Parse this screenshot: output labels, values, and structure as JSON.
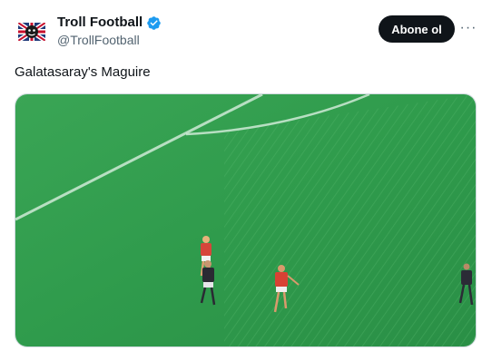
{
  "tweet": {
    "author": {
      "display_name": "Troll Football",
      "handle": "@TrollFootball",
      "verified": true,
      "avatar_icon": "union-jack-crest-icon"
    },
    "follow_label": "Abone ol",
    "more_icon": "more-options-icon",
    "text": "Galatasaray's Maguire",
    "media": {
      "type": "video-frame",
      "description_icon": "football-pitch-scene"
    }
  },
  "colors": {
    "verified_blue": "#1d9bf0",
    "follow_button_bg": "#0f1419",
    "handle_gray": "#536471",
    "pitch_green": "#2f9b4c"
  }
}
